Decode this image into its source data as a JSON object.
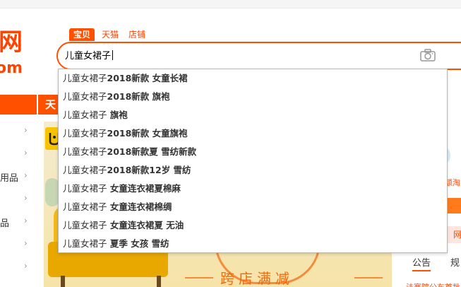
{
  "search": {
    "tabs": [
      {
        "label": "宝贝",
        "active": true
      },
      {
        "label": "天猫",
        "active": false
      },
      {
        "label": "店铺",
        "active": false
      }
    ],
    "query": "儿童女裙子",
    "camera_icon": "camera-icon"
  },
  "logo": {
    "cn": "网",
    "en": "om"
  },
  "suggestions": [
    {
      "base": "儿童女裙子",
      "rest": "2018新款 女童长裙"
    },
    {
      "base": "儿童女裙子",
      "rest": "2018新款 旗袍"
    },
    {
      "base": "儿童女裙子",
      "rest": " 旗袍"
    },
    {
      "base": "儿童女裙子",
      "rest": "2018新款 女童旗袍"
    },
    {
      "base": "儿童女裙子",
      "rest": "2018新款夏 雪纺新款"
    },
    {
      "base": "儿童女裙子",
      "rest": "2018新款12岁 雪纺"
    },
    {
      "base": "儿童女裙子",
      "rest": " 女童连衣裙夏棉麻"
    },
    {
      "base": "儿童女裙子",
      "rest": " 女童连衣裙棉绸"
    },
    {
      "base": "儿童女裙子",
      "rest": " 女童连衣裙夏 无油"
    },
    {
      "base": "儿童女裙子",
      "rest": " 夏季 女孩 雪纺"
    }
  ],
  "left_categories": [
    {
      "label": ""
    },
    {
      "label": ""
    },
    {
      "label": "用品"
    },
    {
      "label": ""
    },
    {
      "label": "品"
    },
    {
      "label": ""
    },
    {
      "label": ""
    }
  ],
  "tmall_bar": "天",
  "banner": {
    "promo": "跨店满减"
  },
  "right_panel": {
    "notice_tab": "公告",
    "rule_tab": "规",
    "line1": "法赛院公布首批",
    "red_text": "额淘",
    "pink_text": "网"
  },
  "colors": {
    "accent": "#ff5000",
    "brand": "#ff4400"
  }
}
